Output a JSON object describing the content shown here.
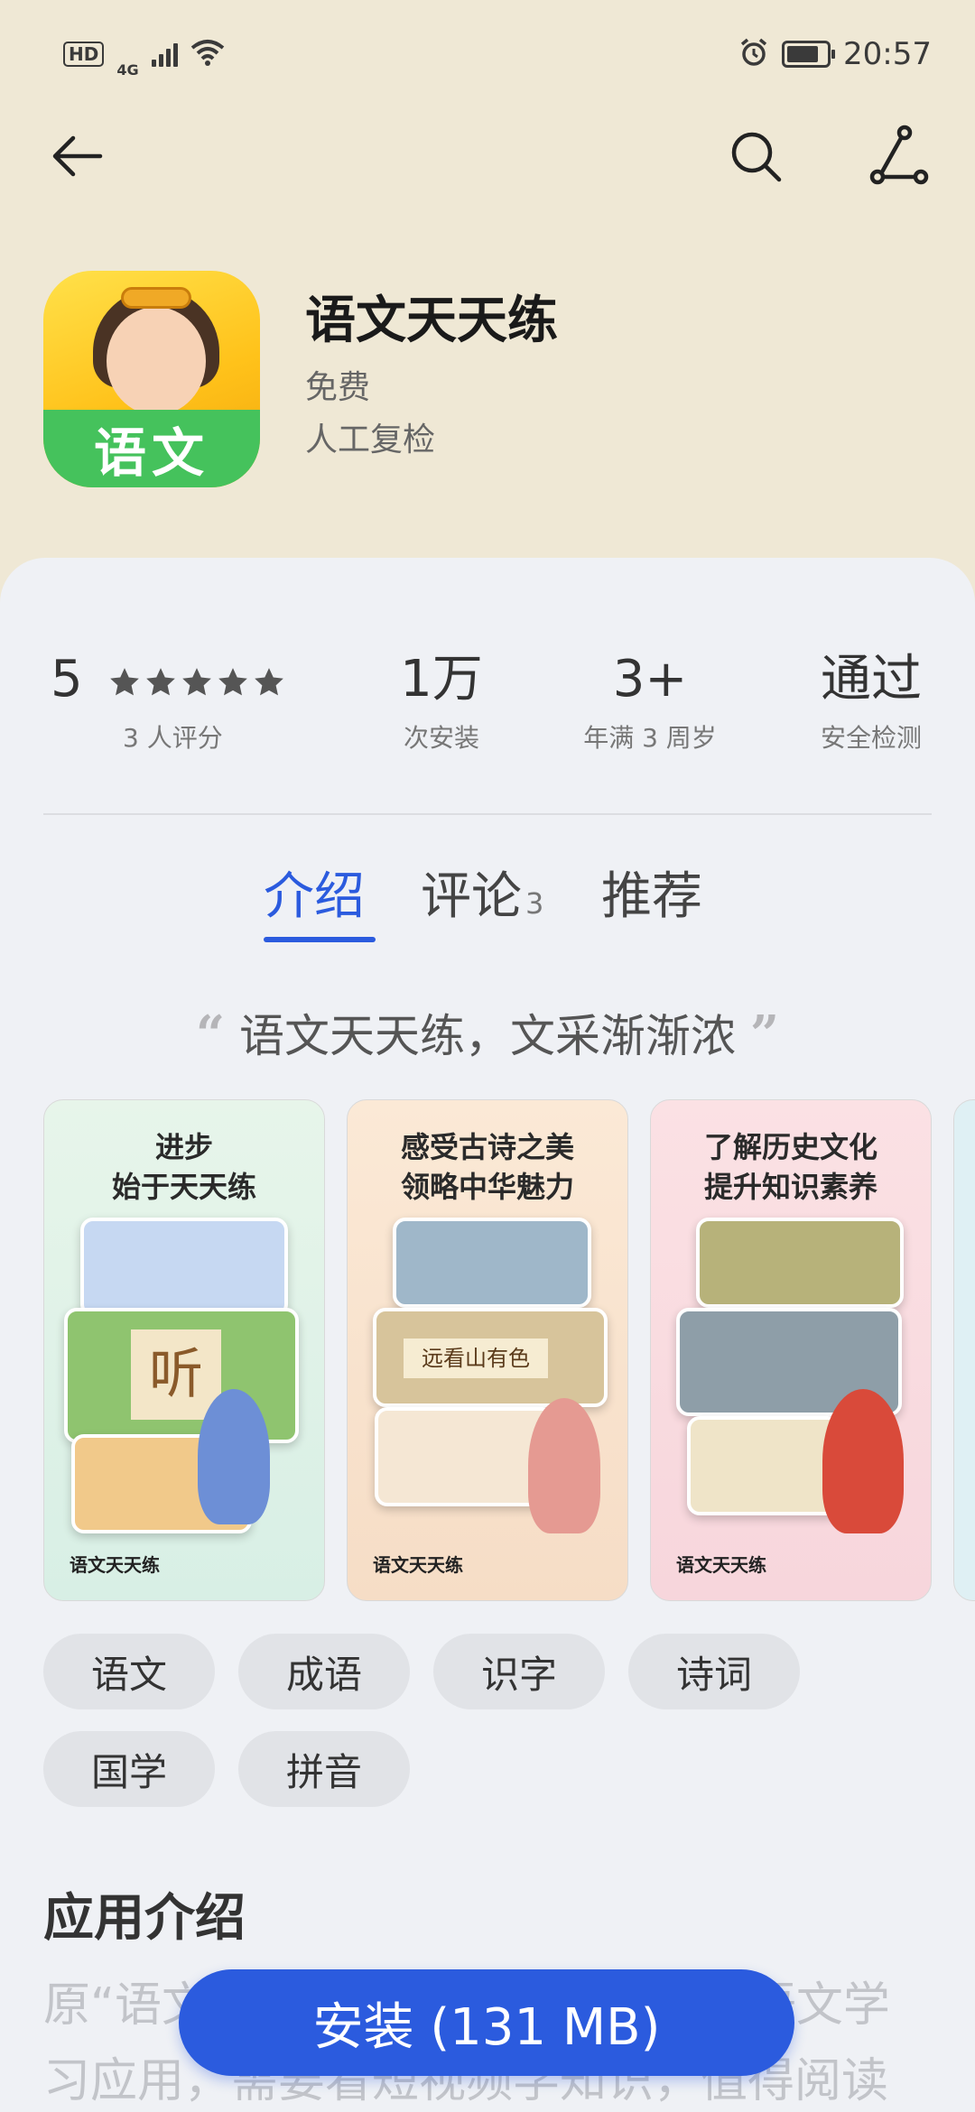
{
  "status_bar": {
    "hd": "HD",
    "network": "4G",
    "time": "20:57"
  },
  "app": {
    "icon_text": "语文",
    "name": "语文天天练",
    "price": "免费",
    "review_note": "人工复检"
  },
  "stats": {
    "rating": "5",
    "rating_label": "3 人评分",
    "rating_stars": 5,
    "installs": "1万",
    "installs_label": "次安装",
    "age": "3+",
    "age_label": "年满 3 周岁",
    "security": "通过",
    "security_label": "安全检测"
  },
  "tabs": [
    {
      "label": "介绍",
      "count": ""
    },
    {
      "label": "评论",
      "count": "3"
    },
    {
      "label": "推荐",
      "count": ""
    }
  ],
  "quote": "语文天天练，文采渐渐浓",
  "screenshots": [
    {
      "line1": "进步",
      "line2": "始于天天练",
      "brand": "语文天天练",
      "card_text": "听"
    },
    {
      "line1": "感受古诗之美",
      "line2": "领略中华魅力",
      "brand": "语文天天练",
      "card_text": "远看山有色"
    },
    {
      "line1": "了解历史文化",
      "line2": "提升知识素养",
      "brand": "语文天天练",
      "card_text": ""
    }
  ],
  "tags": [
    "语文",
    "成语",
    "识字",
    "诗词",
    "国学",
    "拼音"
  ],
  "section_title": "应用介绍",
  "description": "原“语文天天练”是一款寓教于乐的语文学习应用，需要看短视频学知识，值得阅读精彩内容",
  "install_button": "安装 (131 MB)",
  "colors": {
    "accent": "#2b5bde",
    "header_bg": "#efe8d5",
    "sheet_bg": "#eff1f5"
  }
}
